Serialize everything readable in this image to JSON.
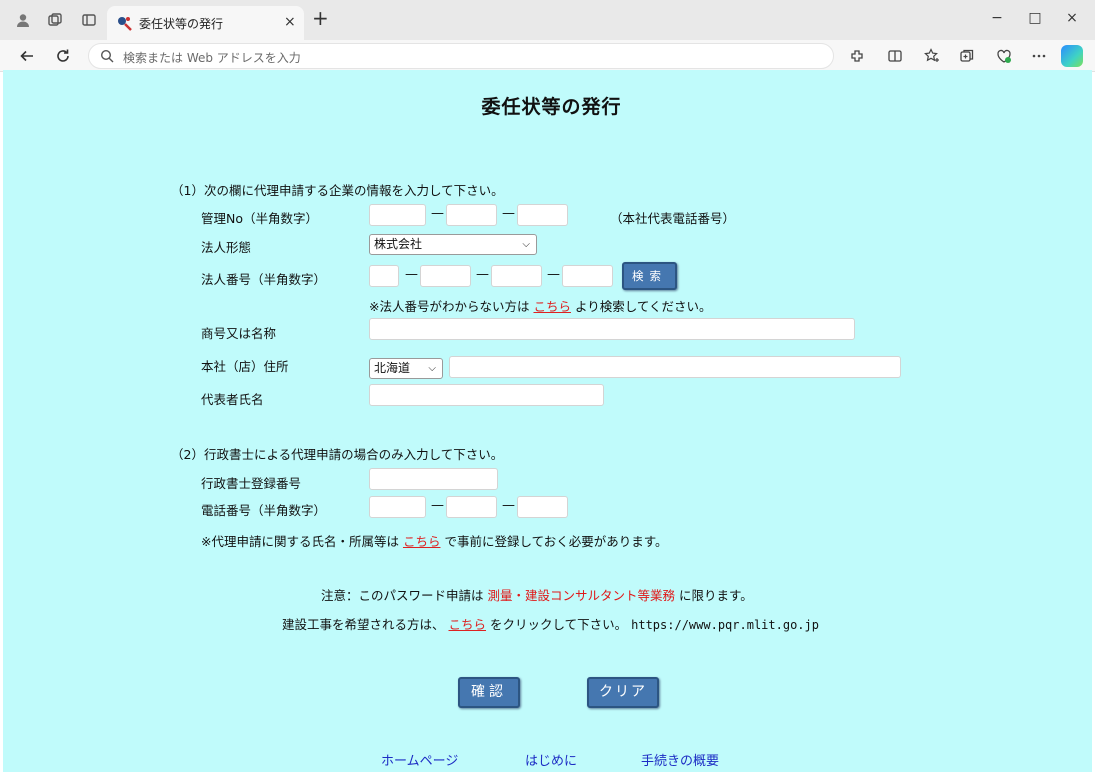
{
  "browser": {
    "tab_title": "委任状等の発行",
    "address_placeholder": "検索または Web アドレスを入力",
    "tab_close": "×",
    "new_tab": "+",
    "win_min": "−",
    "win_max": "□",
    "win_close": "×"
  },
  "page": {
    "title": "委任状等の発行",
    "section1": {
      "heading": "（1）次の欄に代理申請する企業の情報を入力して下さい。",
      "kanri_label": "管理No（半角数字）",
      "kanri_note": "（本社代表電話番号）",
      "houjin_keitai_label": "法人形態",
      "houjin_keitai_value": "株式会社",
      "houjin_bangou_label": "法人番号（半角数字）",
      "search_button": "検索",
      "bangou_note_prefix": "※法人番号がわからない方は",
      "bangou_note_link": "こちら",
      "bangou_note_suffix": "より検索してください。",
      "shougou_label": "商号又は名称",
      "address_label": "本社（店）住所",
      "prefecture_value": "北海道",
      "daihyo_label": "代表者氏名",
      "dash": "—"
    },
    "section2": {
      "heading": "（2）行政書士による代理申請の場合のみ入力して下さい。",
      "gyousei_label": "行政書士登録番号",
      "phone_label": "電話番号（半角数字）",
      "note_prefix": "※代理申請に関する氏名・所属等は",
      "note_link": "こちら",
      "note_suffix": "で事前に登録しておく必要があります。"
    },
    "caution": {
      "prefix": "注意：このパスワード申請は",
      "highlight": "測量・建設コンサルタント等業務",
      "suffix": "に限ります。"
    },
    "construction": {
      "prefix": "建設工事を希望される方は、",
      "link": "こちら",
      "suffix": "をクリックして下さい。",
      "url": "https://www.pqr.mlit.go.jp"
    },
    "buttons": {
      "confirm": "確認",
      "clear": "クリア"
    },
    "footer": {
      "home": "ホームページ",
      "intro": "はじめに",
      "overview": "手続きの概要"
    }
  }
}
